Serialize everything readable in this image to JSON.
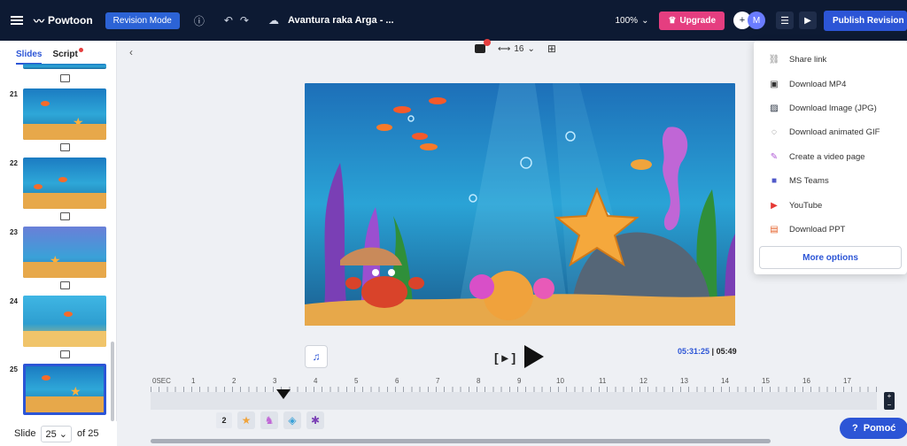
{
  "topbar": {
    "logo_text": "Powtoon",
    "mode_label": "Revision Mode",
    "project_title": "Avantura raka Arga - ...",
    "zoom": "100%",
    "upgrade_label": "Upgrade",
    "avatar_initial": "M",
    "publish_label": "Publish Revision"
  },
  "sidebar": {
    "tab_slides": "Slides",
    "tab_script": "Script",
    "slide_numbers": [
      "21",
      "22",
      "23",
      "24",
      "25"
    ],
    "footer_label": "Slide",
    "current_slide": "25",
    "total_label": "of 25"
  },
  "toolbar": {
    "ratio_value": "16"
  },
  "player": {
    "current_time": "05:31:25",
    "total_time": "05:49",
    "bracket_label": "[ ▸ ]"
  },
  "timeline": {
    "ticks": [
      "0SEC",
      "1",
      "2",
      "3",
      "4",
      "5",
      "6",
      "7",
      "8",
      "9",
      "10",
      "11",
      "12",
      "13",
      "14",
      "15",
      "16",
      "17"
    ],
    "layer_badge": "2"
  },
  "dropdown": {
    "items": [
      {
        "icon": "link-icon",
        "glyph": "⛓",
        "label": "Share link"
      },
      {
        "icon": "mp4-icon",
        "glyph": "▣",
        "label": "Download MP4"
      },
      {
        "icon": "image-icon",
        "glyph": "▨",
        "label": "Download Image (JPG)"
      },
      {
        "icon": "gif-icon",
        "glyph": "◌",
        "label": "Download animated GIF"
      },
      {
        "icon": "video-page-icon",
        "glyph": "✎",
        "label": "Create a video page"
      },
      {
        "icon": "teams-icon",
        "glyph": "■",
        "label": "MS Teams"
      },
      {
        "icon": "youtube-icon",
        "glyph": "▶",
        "label": "YouTube"
      },
      {
        "icon": "ppt-icon",
        "glyph": "▤",
        "label": "Download PPT"
      }
    ],
    "more_label": "More options"
  },
  "help": {
    "label": "Pomoć"
  },
  "colors": {
    "topbar_bg": "#0d1a33",
    "accent": "#2c55d6",
    "upgrade": "#e53e80"
  }
}
